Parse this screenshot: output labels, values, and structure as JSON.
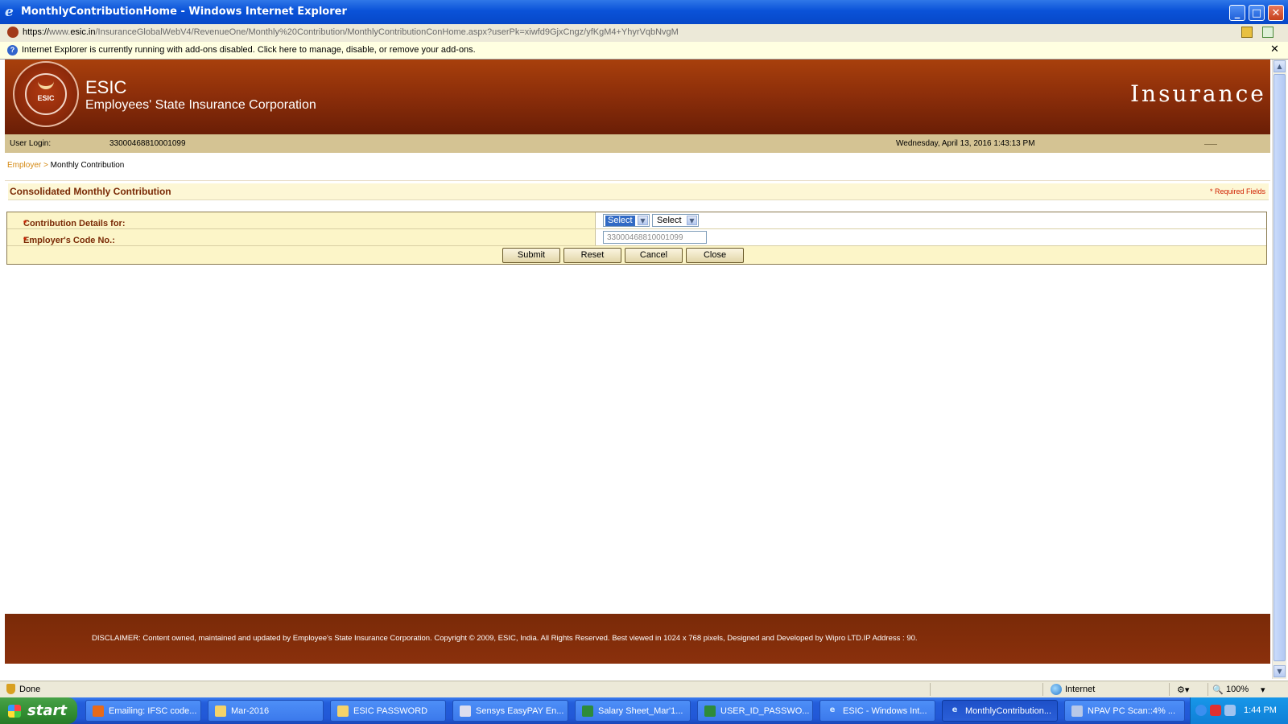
{
  "window": {
    "title": "MonthlyContributionHome - Windows Internet Explorer"
  },
  "address": {
    "prefix": "https://",
    "host_pre": "www.",
    "host": "esic.in",
    "path": "/InsuranceGlobalWebV4/RevenueOne/Monthly%20Contribution/MonthlyContributionConHome.aspx?userPk=xiwfd9GjxCngz/yfKgM4+YhyrVqbNvgM"
  },
  "infobar": {
    "text": "Internet Explorer is currently running with add-ons disabled. Click here to manage, disable, or remove your add-ons."
  },
  "header": {
    "logo_text": "ESIC",
    "brand": "ESIC",
    "org": "Employees' State Insurance Corporation",
    "section": "Insurance"
  },
  "userbar": {
    "label": "User Login:",
    "user_id": "33000468810001099",
    "datetime": "Wednesday, April 13, 2016 1:43:13 PM"
  },
  "breadcrumb": {
    "link": "Employer",
    "sep": " > ",
    "current": "Monthly Contribution"
  },
  "form": {
    "title": "Consolidated Monthly Contribution",
    "required_note": "* Required Fields",
    "contribution_label": "Contribution Details for:",
    "required_mark": "*",
    "select1": "Select",
    "select2": "Select",
    "employer_code_label": "Employer's Code No.:",
    "employer_code_value": "33000468810001099",
    "buttons": {
      "submit": "Submit",
      "reset": "Reset",
      "cancel": "Cancel",
      "close": "Close"
    }
  },
  "footer": {
    "disclaimer": "DISCLAIMER: Content owned, maintained and updated by Employee's State Insurance Corporation. Copyright © 2009, ESIC, India. All Rights Reserved. Best viewed in 1024 x 768 pixels, Designed and Developed by Wipro LTD.IP Address : 90."
  },
  "statusbar": {
    "done": "Done",
    "zone": "Internet",
    "zoom": "100%"
  },
  "taskbar": {
    "start": "start",
    "items": [
      {
        "label": "Emailing: IFSC code..."
      },
      {
        "label": "Mar-2016"
      },
      {
        "label": "ESIC PASSWORD"
      },
      {
        "label": "Sensys EasyPAY En..."
      },
      {
        "label": "Salary Sheet_Mar'1..."
      },
      {
        "label": "USER_ID_PASSWO..."
      },
      {
        "label": "ESIC - Windows Int..."
      },
      {
        "label": "MonthlyContribution..."
      },
      {
        "label": "NPAV PC Scan::4% ..."
      }
    ],
    "clock": "1:44 PM"
  }
}
